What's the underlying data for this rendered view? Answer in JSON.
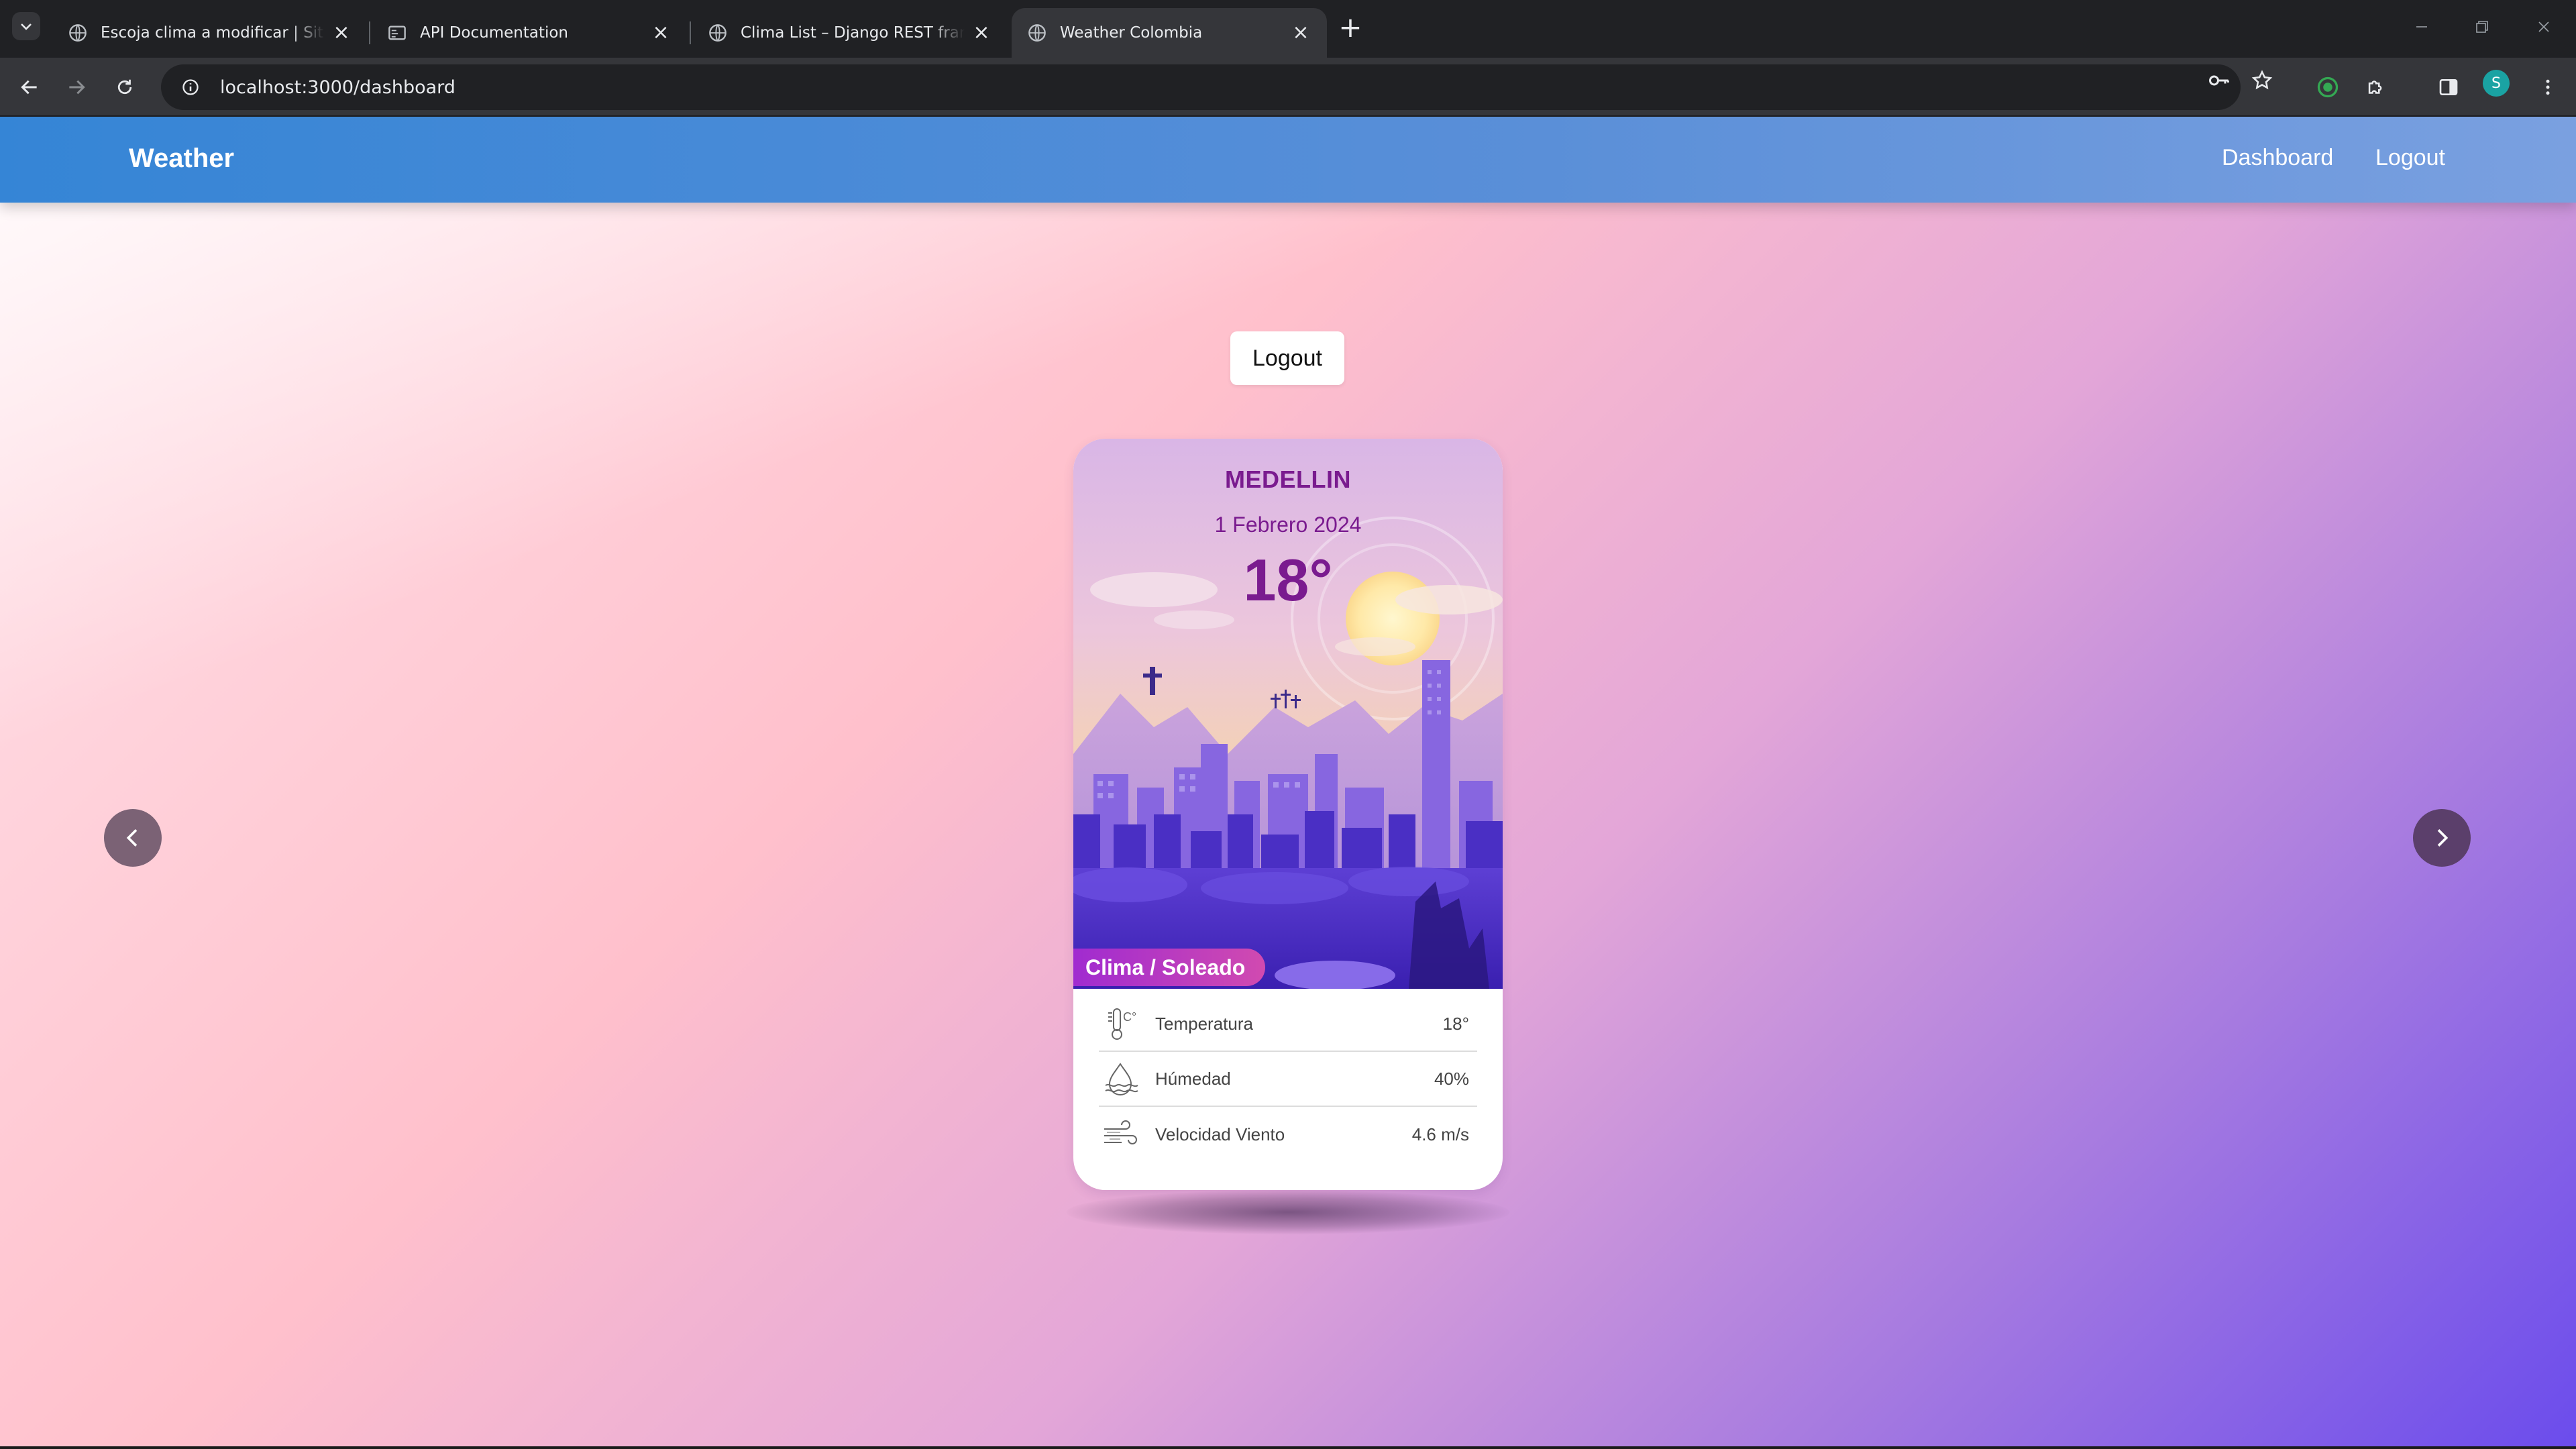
{
  "browser": {
    "tabs": [
      {
        "title": "Escoja clima a modificar | Sitio de administración de Django",
        "active": false
      },
      {
        "title": "API Documentation",
        "active": false
      },
      {
        "title": "Clima List – Django REST framework",
        "active": false
      },
      {
        "title": "Weather Colombia",
        "active": true
      }
    ],
    "new_tab_label": "+",
    "address": "localhost:3000/dashboard",
    "profile_initial": "S"
  },
  "navbar": {
    "brand": "Weather",
    "links": [
      "Dashboard",
      "Logout"
    ]
  },
  "logout_button": "Logout",
  "card": {
    "city": "MEDELLIN",
    "date": "1 Febrero 2024",
    "temperature": "18°",
    "condition": "Clima / Soleado",
    "rows": [
      {
        "icon": "thermometer-icon",
        "label": "Temperatura",
        "value": "18°"
      },
      {
        "icon": "humidity-icon",
        "label": "Húmedad",
        "value": "40%"
      },
      {
        "icon": "wind-icon",
        "label": "Velocidad Viento",
        "value": "4.6 m/s"
      }
    ]
  },
  "colors": {
    "navbar_start": "#3585d6",
    "navbar_end": "#7aa0e0",
    "card_text": "#7a1b8f",
    "badge": "#a02bd0",
    "arrow_left": "#7b6275",
    "arrow_right": "#5b3f6b"
  }
}
